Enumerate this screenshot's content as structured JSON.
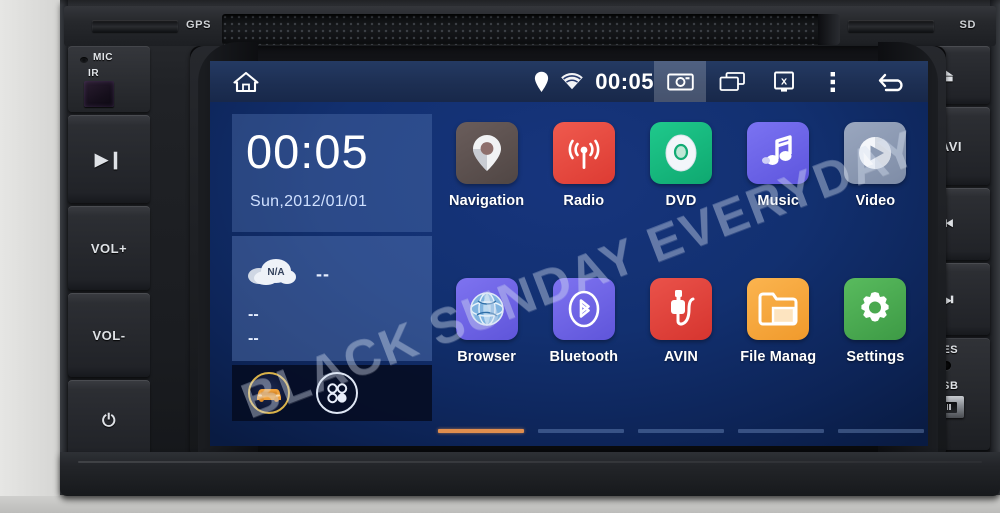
{
  "device": {
    "top_bezel": {
      "gps_slot_label": "GPS",
      "sd_slot_label": "SD",
      "disc_slot_name": "disc-slot"
    },
    "left_panel": {
      "mic_label": "MIC",
      "ir_label": "IR",
      "buttons": [
        {
          "name": "play-pause-button",
          "label": "▶❙"
        },
        {
          "name": "volume-up-button",
          "label": "VOL+"
        },
        {
          "name": "volume-down-button",
          "label": "VOL-"
        },
        {
          "name": "power-button",
          "label": "⏻"
        }
      ]
    },
    "right_panel": {
      "buttons": [
        {
          "name": "eject-button",
          "label": "⏏"
        },
        {
          "name": "navi-button",
          "label": "NAVI"
        },
        {
          "name": "previous-track-button",
          "label": "⏮"
        },
        {
          "name": "next-track-button",
          "label": "⏭"
        }
      ],
      "reset_label": "RES",
      "usb_label": "USB"
    }
  },
  "statusbar": {
    "home_icon": "home-icon",
    "location_icon": "location-pin-icon",
    "wifi_icon": "wifi-icon",
    "time": "00:05",
    "screenshot_icon": "camera-screenshot-icon",
    "recents_icon": "recent-apps-icon",
    "close_icon": "close-window-icon",
    "overflow_icon": "overflow-menu-icon",
    "back_icon": "back-arrow-icon"
  },
  "widgets": {
    "clock": {
      "time": "00:05",
      "date": "Sun,2012/01/01"
    },
    "weather": {
      "condition": "N/A",
      "temperature": "--",
      "high": "--",
      "low": "--",
      "icon": "cloud-icon"
    },
    "dock": [
      {
        "name": "car-info-button",
        "icon": "car-icon"
      },
      {
        "name": "app-drawer-button",
        "icon": "app-drawer-icon"
      }
    ]
  },
  "apps": [
    {
      "label": "Navigation",
      "icon": "map-pin-icon",
      "color": "#5b4f4f"
    },
    {
      "label": "Radio",
      "icon": "radio-waves-icon",
      "color": "#e8453c"
    },
    {
      "label": "DVD",
      "icon": "disc-icon",
      "color": "#14b87f"
    },
    {
      "label": "Music",
      "icon": "music-note-icon",
      "color": "#6b63e8"
    },
    {
      "label": "Video",
      "icon": "play-circle-icon",
      "color": "#8c9ab5"
    },
    {
      "label": "Browser",
      "icon": "globe-icon",
      "color": "#6f63e6"
    },
    {
      "label": "Bluetooth",
      "icon": "bluetooth-icon",
      "color": "#6f63e6"
    },
    {
      "label": "AVIN",
      "icon": "av-plug-icon",
      "color": "#e0413c"
    },
    {
      "label": "File Manag",
      "icon": "folder-icon",
      "color": "#f5a83c"
    },
    {
      "label": "Settings",
      "icon": "gear-icon",
      "color": "#49a94f"
    }
  ],
  "pager": {
    "pages": 5,
    "active": 1
  },
  "watermark": {
    "text": "BLACK SUNDAY EVERYDAY"
  },
  "colors": {
    "accent_orange": "#e08e4e",
    "statusbar_blue": "#1d2f53",
    "desktop_blue": "#123070",
    "dock_gold": "#d9b24a"
  }
}
